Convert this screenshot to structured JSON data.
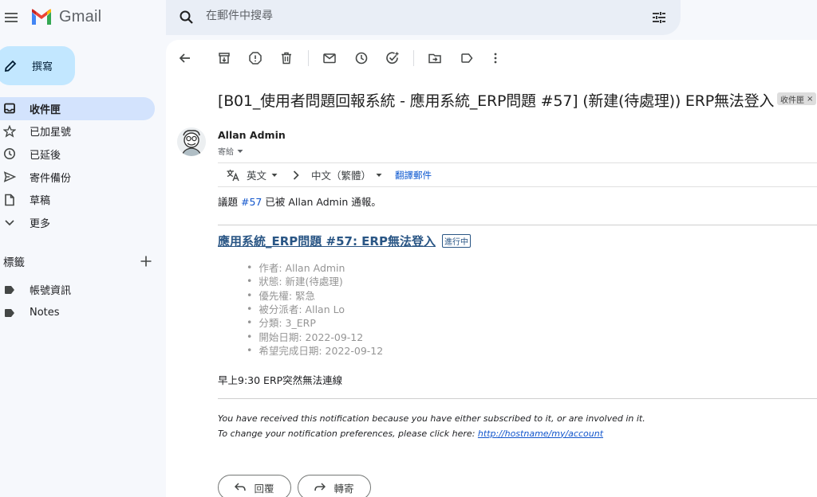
{
  "app": {
    "name": "Gmail"
  },
  "search": {
    "placeholder": "在郵件中搜尋"
  },
  "sidebar": {
    "compose_label": "撰寫",
    "items": [
      {
        "label": "收件匣",
        "icon": "inbox-icon",
        "active": true
      },
      {
        "label": "已加星號",
        "icon": "star-icon"
      },
      {
        "label": "已延後",
        "icon": "clock-icon"
      },
      {
        "label": "寄件備份",
        "icon": "send-icon"
      },
      {
        "label": "草稿",
        "icon": "draft-icon"
      },
      {
        "label": "更多",
        "icon": "chevron-down-icon"
      }
    ],
    "labels_header": "標籤",
    "labels": [
      {
        "label": "帳號資訊",
        "icon": "label-icon"
      },
      {
        "label": "Notes",
        "icon": "label-icon"
      }
    ]
  },
  "message": {
    "subject": "[B01_使用者問題回報系統 - 應用系統_ERP問題 #57] (新建(待處理)) ERP無法登入",
    "inbox_chip": "收件匣",
    "sender": "Allan Admin",
    "to_me": "寄給",
    "translate": {
      "from_lang": "英文",
      "to_lang": "中文（繁體）",
      "action": "翻譯郵件"
    },
    "notice_prefix": "議題",
    "notice_link": "#57",
    "notice_suffix": "已被 Allan Admin 通報。",
    "issue_title": "應用系統_ERP問題 #57: ERP無法登入",
    "issue_status": "進行中",
    "attributes": [
      "作者: Allan Admin",
      "狀態: 新建(待處理)",
      "優先權: 緊急",
      "被分派者: Allan Lo",
      "分類: 3_ERP",
      "開始日期: 2022-09-12",
      "希望完成日期: 2022-09-12"
    ],
    "description": "早上9:30 ERP突然無法連線",
    "footer_line1": "You have received this notification because you have either subscribed to it, or are involved in it.",
    "footer_line2_prefix": "To change your notification preferences, please click here: ",
    "footer_link": "http://hostname/my/account",
    "reply_label": "回覆",
    "forward_label": "轉寄"
  },
  "colors": {
    "accent": "#c2e7ff",
    "active_nav": "#d3e3fd",
    "link": "#2a5685"
  }
}
